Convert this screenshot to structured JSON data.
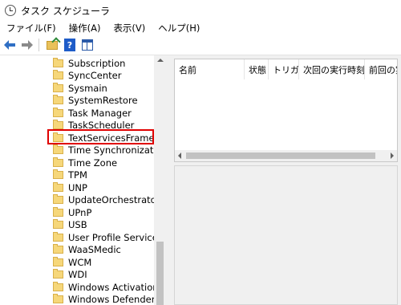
{
  "window": {
    "title": "タスク スケジューラ",
    "icon": "clock-icon"
  },
  "menubar": {
    "items": [
      "ファイル(F)",
      "操作(A)",
      "表示(V)",
      "ヘルプ(H)"
    ]
  },
  "toolbar": {
    "buttons": [
      "back-arrow-icon",
      "forward-arrow-icon",
      "folder-up-icon",
      "help-icon",
      "show-hide-pane-icon"
    ],
    "help_label": "?"
  },
  "tree": {
    "items": [
      "Subscription",
      "SyncCenter",
      "Sysmain",
      "SystemRestore",
      "Task Manager",
      "TaskScheduler",
      "TextServicesFramework",
      "Time Synchronization",
      "Time Zone",
      "TPM",
      "UNP",
      "UpdateOrchestrator",
      "UPnP",
      "USB",
      "User Profile Service",
      "WaaSMedic",
      "WCM",
      "WDI",
      "Windows Activation Technologies",
      "Windows Defender"
    ],
    "selected": "TextServicesFramework",
    "highlight_color": "#e00000"
  },
  "task_list": {
    "columns": [
      "名前",
      "状態",
      "トリガー",
      "次回の実行時刻",
      "前回の実"
    ]
  }
}
